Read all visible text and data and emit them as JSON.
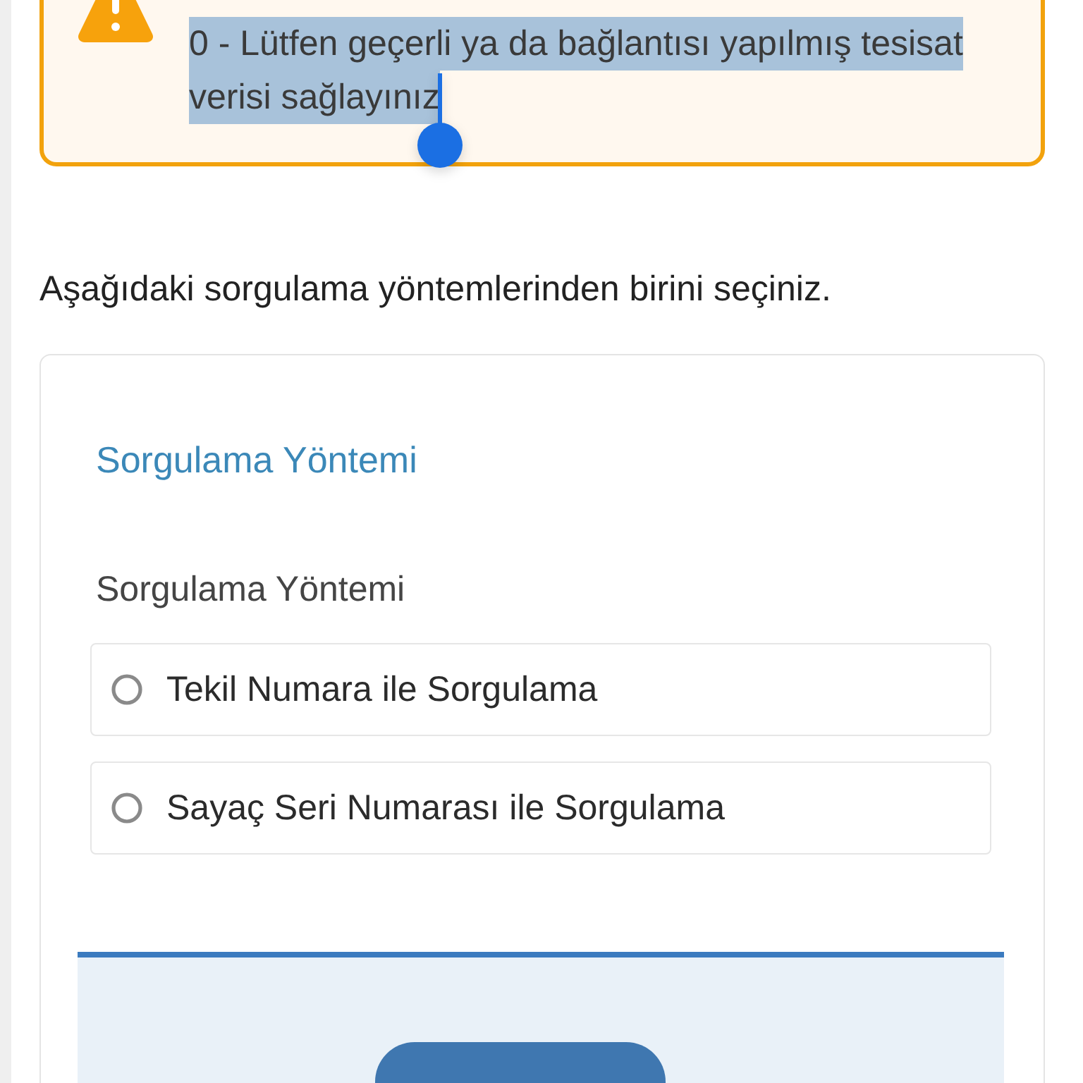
{
  "alert": {
    "message": "0 - Lütfen geçerli ya da bağlantısı yapılmış tesisat verisi sağlayınız",
    "text_selected": true
  },
  "instruction": "Aşağıdaki sorgulama yöntemlerinden birini seçiniz.",
  "query_method": {
    "title": "Sorgulama Yöntemi",
    "field_label": "Sorgulama Yöntemi",
    "options": [
      {
        "label": "Tekil Numara ile Sorgulama",
        "selected": false
      },
      {
        "label": "Sayaç Seri Numarası ile Sorgulama",
        "selected": false
      }
    ]
  },
  "action_panel": {
    "buttons": [
      {
        "kind": "primary"
      }
    ]
  }
}
